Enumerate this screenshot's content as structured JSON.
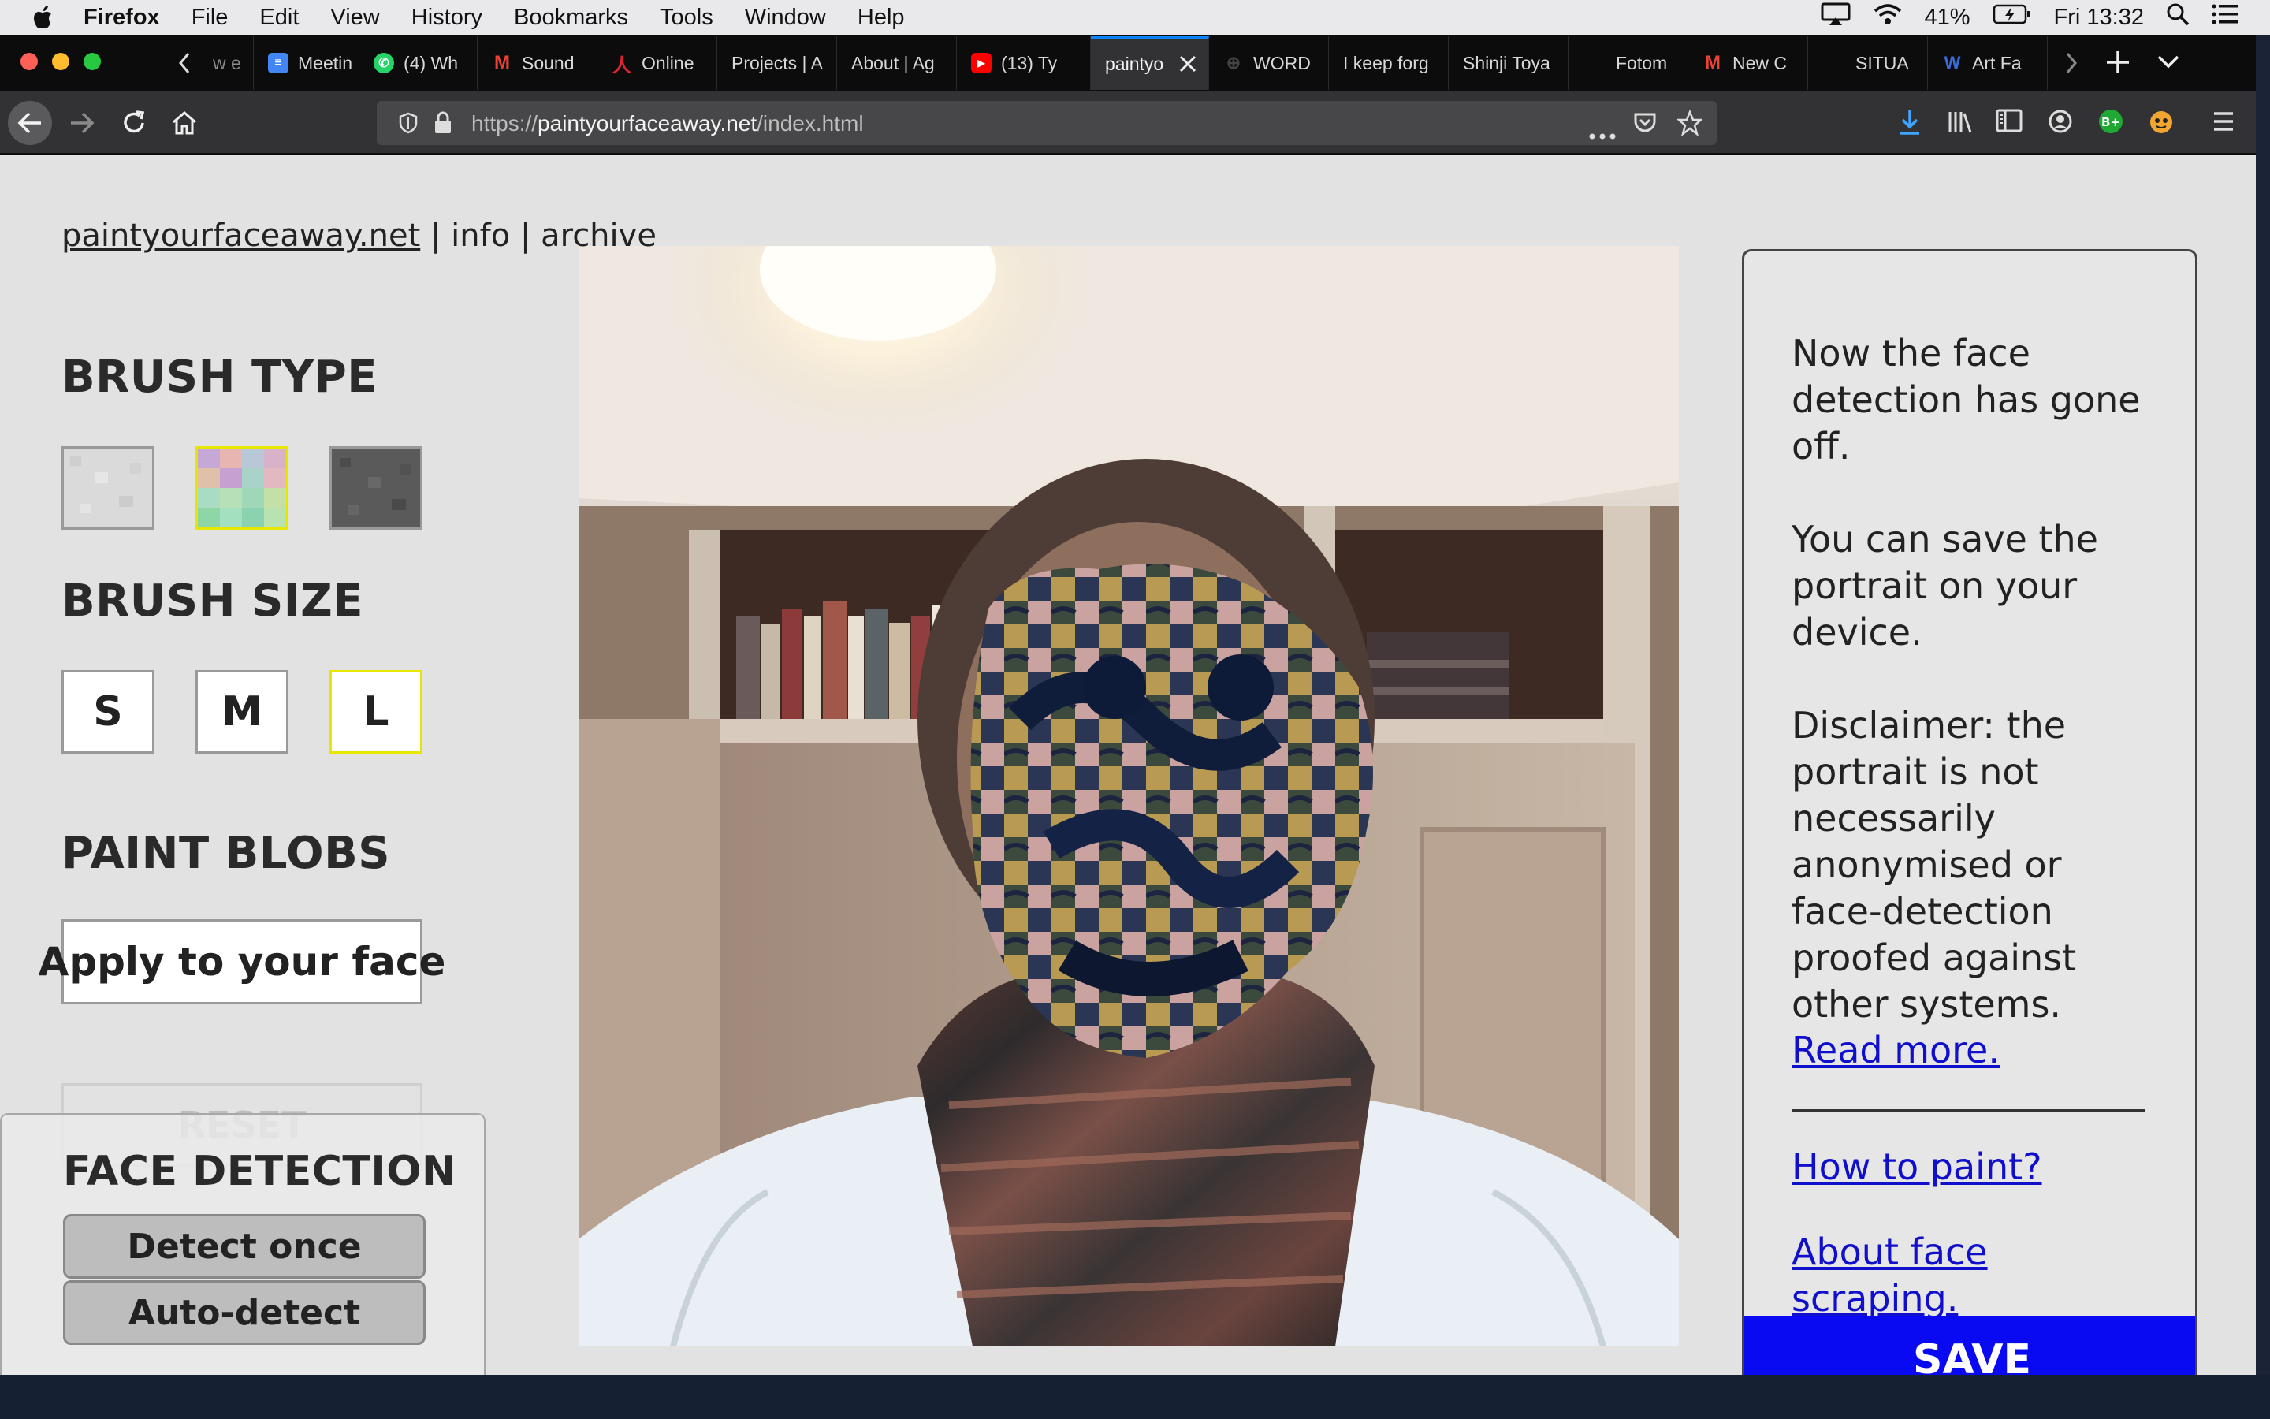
{
  "menubar": {
    "app_name": "Firefox",
    "items": [
      "File",
      "Edit",
      "View",
      "History",
      "Bookmarks",
      "Tools",
      "Window",
      "Help"
    ],
    "battery": "41%",
    "clock": "Fri 13:32"
  },
  "tabs": [
    {
      "label": "w e",
      "icon": "back-arrow-icon"
    },
    {
      "label": "Meetin",
      "icon": "google-docs-icon"
    },
    {
      "label": "(4) Wh",
      "icon": "whatsapp-icon"
    },
    {
      "label": "Sound",
      "icon": "gmail-icon"
    },
    {
      "label": "Online",
      "icon": "acrobat-icon"
    },
    {
      "label": "Projects | A",
      "icon": "none"
    },
    {
      "label": "About | Ag",
      "icon": "none"
    },
    {
      "label": "(13) Ty",
      "icon": "youtube-icon"
    },
    {
      "label": "paintyo",
      "icon": "none",
      "active": true
    },
    {
      "label": "WORD",
      "icon": "globe-icon"
    },
    {
      "label": "I keep forg",
      "icon": "none"
    },
    {
      "label": "Shinji Toya",
      "icon": "none"
    },
    {
      "label": "Fotom",
      "icon": "none"
    },
    {
      "label": "New C",
      "icon": "gmail-icon"
    },
    {
      "label": "SITUA",
      "icon": "none"
    },
    {
      "label": "Art Fa",
      "icon": "wordpress-icon"
    }
  ],
  "navbar": {
    "url_prefix": "https://",
    "url_host": "paintyourfaceaway.net",
    "url_path": "/index.html"
  },
  "page": {
    "site_nav": {
      "home": "paintyourfaceaway.net",
      "sep1": " | ",
      "info": "info",
      "sep2": " | ",
      "archive": "archive"
    },
    "brush_type": {
      "heading": "BRUSH TYPE",
      "swatches": [
        "light-noise",
        "colour-noise",
        "dark-noise"
      ],
      "selected": "colour-noise"
    },
    "brush_size": {
      "heading": "BRUSH SIZE",
      "options": [
        "S",
        "M",
        "L"
      ],
      "selected": "L"
    },
    "paint_blobs": {
      "heading": "PAINT BLOBS",
      "apply_label": "Apply to your face"
    },
    "reset_label": "RESET",
    "face_detection": {
      "heading": "FACE DETECTION",
      "detect_once": "Detect once",
      "auto_detect": "Auto-detect"
    },
    "panel": {
      "p1": "Now the face detection has gone off.",
      "p2": "You can save the portrait on your device.",
      "p3": "Disclaimer: the portrait is not necessarily anonymised or face-detection proofed against other systems.",
      "read_more": "Read more.",
      "how_to_paint": "How to paint?",
      "about_scraping": "About face scraping.",
      "save": "SAVE"
    }
  },
  "colors": {
    "accent_selected": "#e6e600",
    "save_button": "#0a0af2",
    "link": "#1010cc",
    "active_tab_line": "#0a84ff"
  }
}
